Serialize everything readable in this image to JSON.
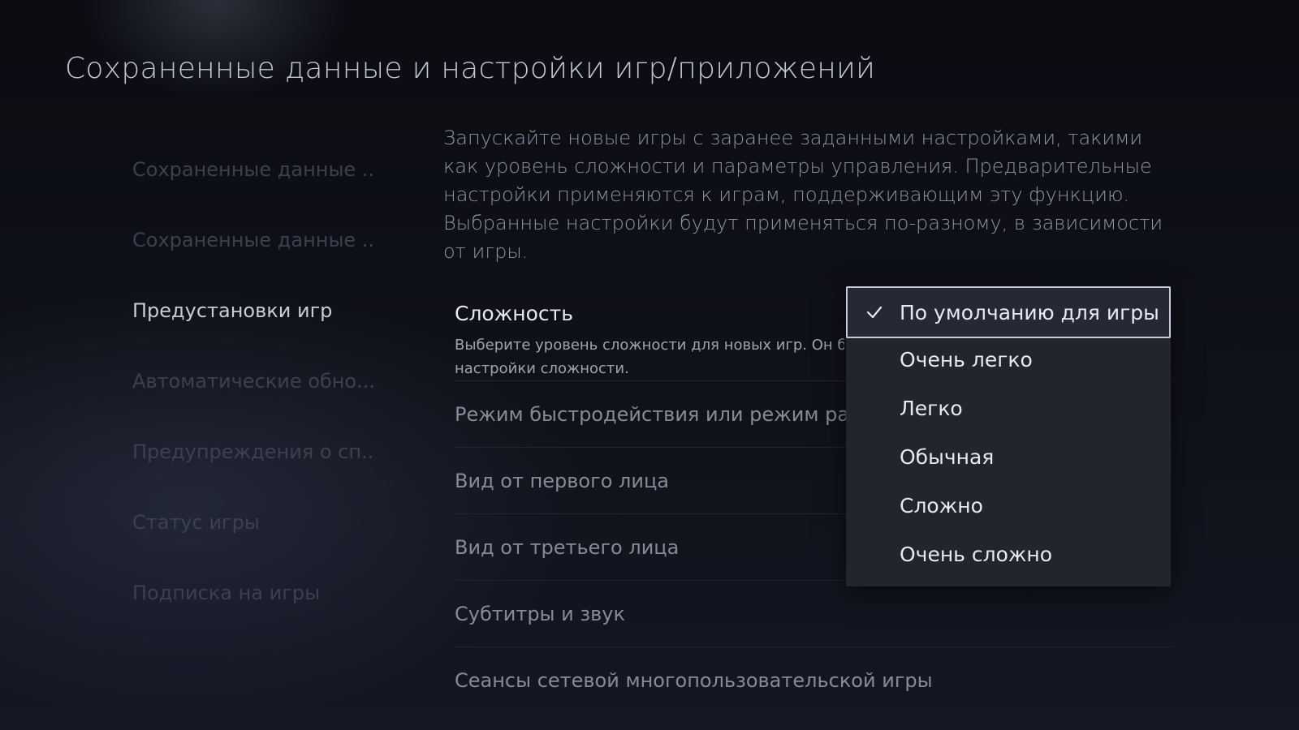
{
  "page": {
    "title": "Сохраненные данные и настройки игр/приложений"
  },
  "sidebar": {
    "items": [
      {
        "label": "Сохраненные данные ..."
      },
      {
        "label": "Сохраненные данные ..."
      },
      {
        "label": "Предустановки игр",
        "active": true
      },
      {
        "label": "Автоматические обно..."
      },
      {
        "label": "Предупреждения о сп..."
      },
      {
        "label": "Статус игры"
      },
      {
        "label": "Подписка на игры"
      }
    ]
  },
  "main": {
    "description": "Запускайте новые игры с заранее заданными настройками, такими как уровень сложности и параметры управления. Предварительные настройки применяются к играм, поддерживающим эту функцию. Выбранные настройки будут применяться по-разному, в зависимости от игры.",
    "difficulty": {
      "title": "Сложность",
      "desc_line1": "Выберите уровень сложности для новых игр. Он б",
      "desc_line2": "настройки сложности."
    },
    "rows": [
      {
        "label": "Режим быстродействия или режим разр"
      },
      {
        "label": "Вид от первого лица"
      },
      {
        "label": "Вид от третьего лица"
      },
      {
        "label": "Субтитры и звук"
      },
      {
        "label": "Сеансы сетевой многопользовательской игры"
      }
    ]
  },
  "dropdown": {
    "selected_index": 0,
    "options": [
      {
        "label": "По умолчанию для игры"
      },
      {
        "label": "Очень легко"
      },
      {
        "label": "Легко"
      },
      {
        "label": "Обычная"
      },
      {
        "label": "Сложно"
      },
      {
        "label": "Очень сложно"
      }
    ]
  },
  "colors": {
    "background": "#10121a",
    "dropdown_bg": "#23252e",
    "focus_border": "#c6cad6"
  },
  "icons": {
    "selected_marker": "check-icon"
  }
}
